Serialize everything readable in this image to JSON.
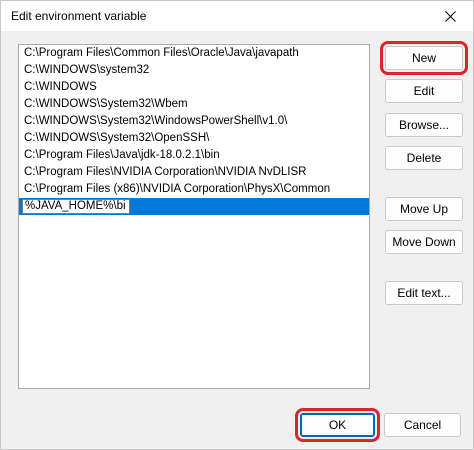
{
  "window": {
    "title": "Edit environment variable",
    "close_glyph": "close-icon"
  },
  "paths": {
    "items": [
      "C:\\Program Files\\Common Files\\Oracle\\Java\\javapath",
      "C:\\WINDOWS\\system32",
      "C:\\WINDOWS",
      "C:\\WINDOWS\\System32\\Wbem",
      "C:\\WINDOWS\\System32\\WindowsPowerShell\\v1.0\\",
      "C:\\WINDOWS\\System32\\OpenSSH\\",
      "C:\\Program Files\\Java\\jdk-18.0.2.1\\bin",
      "C:\\Program Files\\NVIDIA Corporation\\NVIDIA NvDLISR",
      "C:\\Program Files (x86)\\NVIDIA Corporation\\PhysX\\Common"
    ],
    "editing_value": "%JAVA_HOME%\\bin"
  },
  "buttons": {
    "new": "New",
    "edit": "Edit",
    "browse": "Browse...",
    "delete": "Delete",
    "move_up": "Move Up",
    "move_down": "Move Down",
    "edit_text": "Edit text...",
    "ok": "OK",
    "cancel": "Cancel"
  },
  "highlighted_buttons": [
    "new",
    "ok"
  ],
  "colors": {
    "highlight_outline": "#d9262e",
    "selection": "#0078d7",
    "accent": "#0067c0"
  }
}
